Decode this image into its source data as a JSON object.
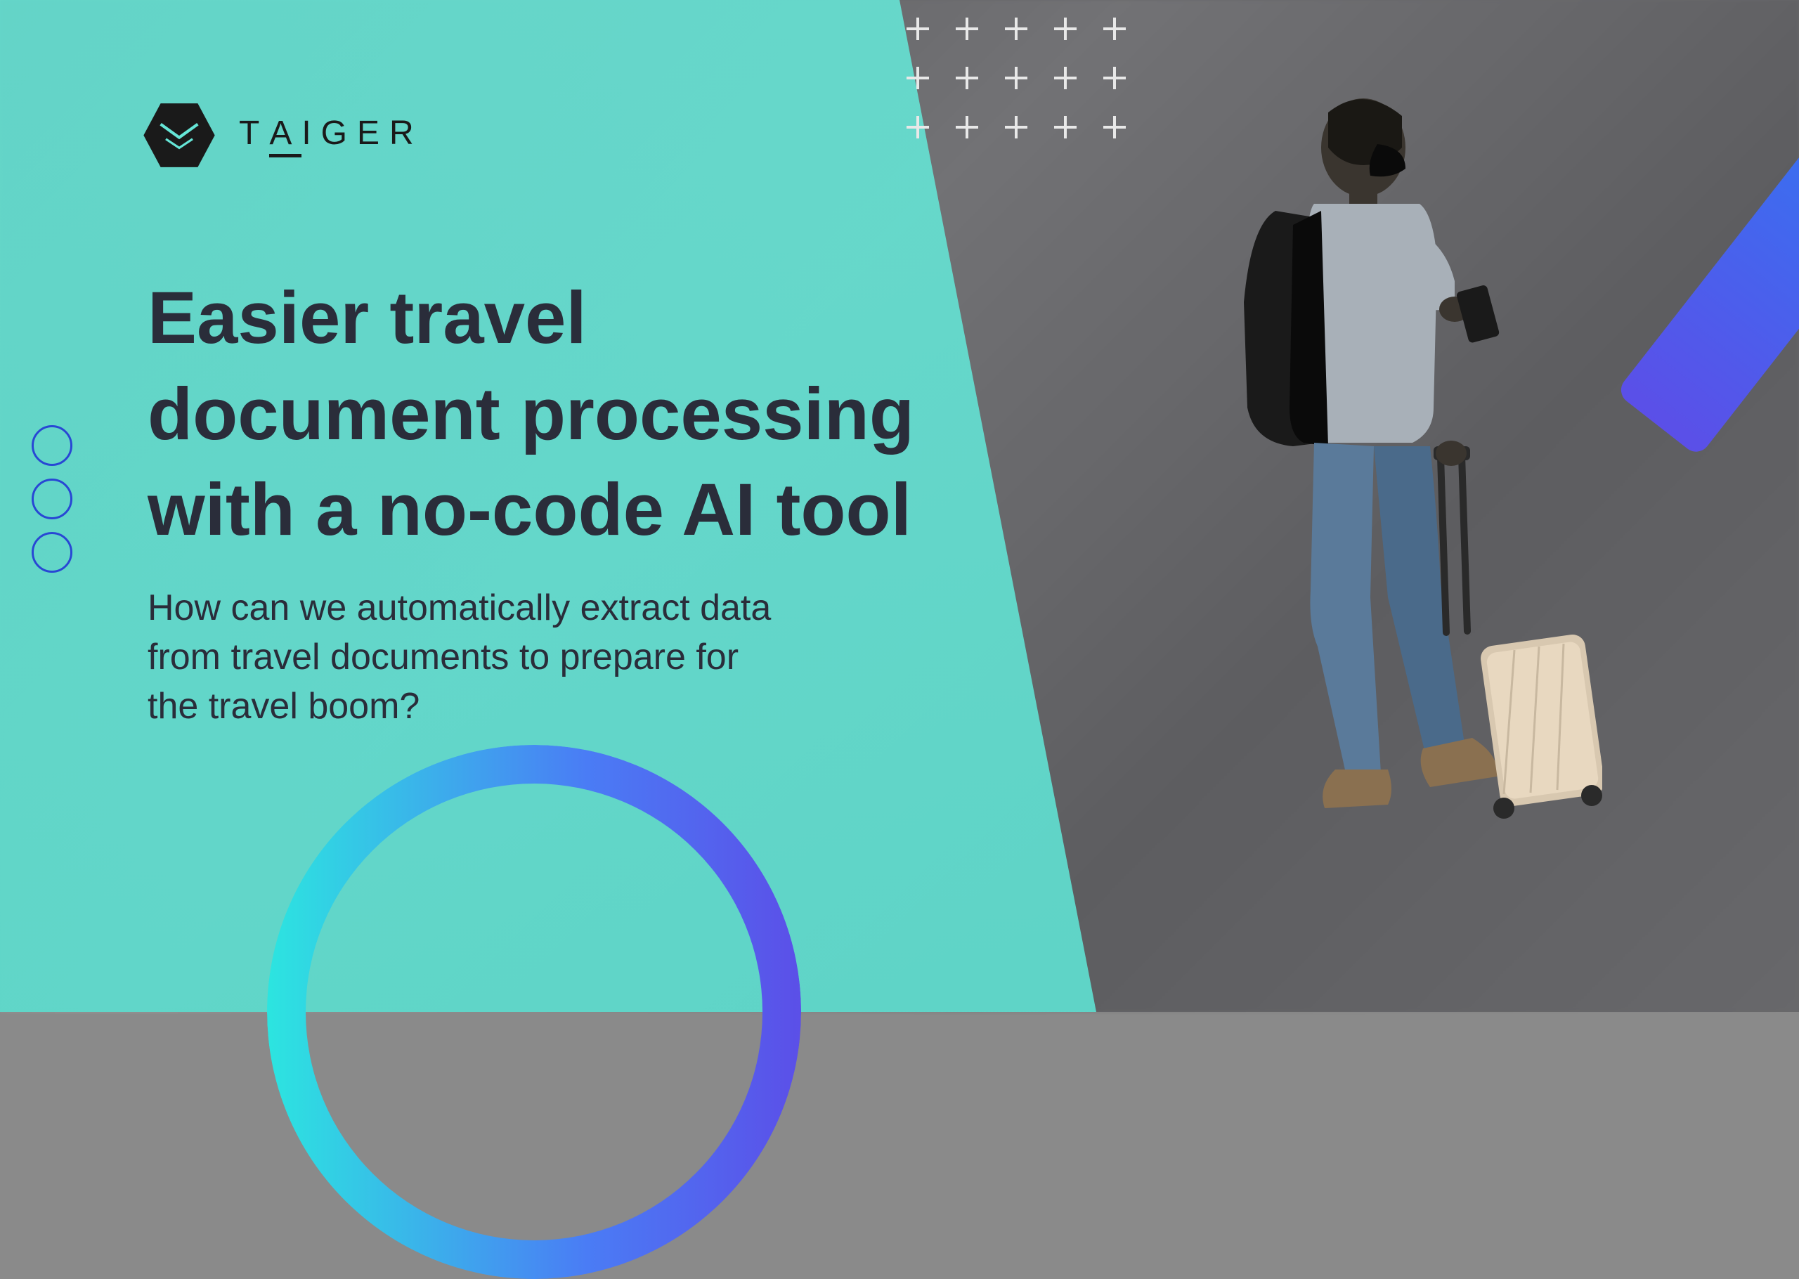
{
  "brand": {
    "name": "TAIGER"
  },
  "heading": "Easier travel document processing with a no-code AI tool",
  "subheading": "How can we automatically extract data from travel documents to prepare for the travel boom?",
  "colors": {
    "teal": "#66e6d7",
    "darkText": "#2a2d3a",
    "accentBlue": "#2847d4",
    "gradientStart": "#2ce5e0",
    "gradientMid": "#3a6ff0",
    "gradientEnd": "#5b4fe8"
  }
}
